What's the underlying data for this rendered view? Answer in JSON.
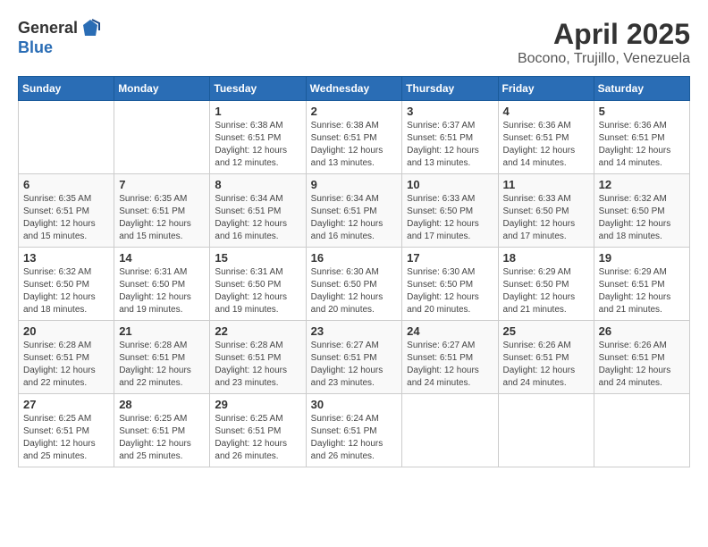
{
  "logo": {
    "general": "General",
    "blue": "Blue"
  },
  "title": {
    "month": "April 2025",
    "location": "Bocono, Trujillo, Venezuela"
  },
  "weekdays": [
    "Sunday",
    "Monday",
    "Tuesday",
    "Wednesday",
    "Thursday",
    "Friday",
    "Saturday"
  ],
  "weeks": [
    [
      {
        "day": "",
        "sunrise": "",
        "sunset": "",
        "daylight": ""
      },
      {
        "day": "",
        "sunrise": "",
        "sunset": "",
        "daylight": ""
      },
      {
        "day": "1",
        "sunrise": "Sunrise: 6:38 AM",
        "sunset": "Sunset: 6:51 PM",
        "daylight": "Daylight: 12 hours and 12 minutes."
      },
      {
        "day": "2",
        "sunrise": "Sunrise: 6:38 AM",
        "sunset": "Sunset: 6:51 PM",
        "daylight": "Daylight: 12 hours and 13 minutes."
      },
      {
        "day": "3",
        "sunrise": "Sunrise: 6:37 AM",
        "sunset": "Sunset: 6:51 PM",
        "daylight": "Daylight: 12 hours and 13 minutes."
      },
      {
        "day": "4",
        "sunrise": "Sunrise: 6:36 AM",
        "sunset": "Sunset: 6:51 PM",
        "daylight": "Daylight: 12 hours and 14 minutes."
      },
      {
        "day": "5",
        "sunrise": "Sunrise: 6:36 AM",
        "sunset": "Sunset: 6:51 PM",
        "daylight": "Daylight: 12 hours and 14 minutes."
      }
    ],
    [
      {
        "day": "6",
        "sunrise": "Sunrise: 6:35 AM",
        "sunset": "Sunset: 6:51 PM",
        "daylight": "Daylight: 12 hours and 15 minutes."
      },
      {
        "day": "7",
        "sunrise": "Sunrise: 6:35 AM",
        "sunset": "Sunset: 6:51 PM",
        "daylight": "Daylight: 12 hours and 15 minutes."
      },
      {
        "day": "8",
        "sunrise": "Sunrise: 6:34 AM",
        "sunset": "Sunset: 6:51 PM",
        "daylight": "Daylight: 12 hours and 16 minutes."
      },
      {
        "day": "9",
        "sunrise": "Sunrise: 6:34 AM",
        "sunset": "Sunset: 6:51 PM",
        "daylight": "Daylight: 12 hours and 16 minutes."
      },
      {
        "day": "10",
        "sunrise": "Sunrise: 6:33 AM",
        "sunset": "Sunset: 6:50 PM",
        "daylight": "Daylight: 12 hours and 17 minutes."
      },
      {
        "day": "11",
        "sunrise": "Sunrise: 6:33 AM",
        "sunset": "Sunset: 6:50 PM",
        "daylight": "Daylight: 12 hours and 17 minutes."
      },
      {
        "day": "12",
        "sunrise": "Sunrise: 6:32 AM",
        "sunset": "Sunset: 6:50 PM",
        "daylight": "Daylight: 12 hours and 18 minutes."
      }
    ],
    [
      {
        "day": "13",
        "sunrise": "Sunrise: 6:32 AM",
        "sunset": "Sunset: 6:50 PM",
        "daylight": "Daylight: 12 hours and 18 minutes."
      },
      {
        "day": "14",
        "sunrise": "Sunrise: 6:31 AM",
        "sunset": "Sunset: 6:50 PM",
        "daylight": "Daylight: 12 hours and 19 minutes."
      },
      {
        "day": "15",
        "sunrise": "Sunrise: 6:31 AM",
        "sunset": "Sunset: 6:50 PM",
        "daylight": "Daylight: 12 hours and 19 minutes."
      },
      {
        "day": "16",
        "sunrise": "Sunrise: 6:30 AM",
        "sunset": "Sunset: 6:50 PM",
        "daylight": "Daylight: 12 hours and 20 minutes."
      },
      {
        "day": "17",
        "sunrise": "Sunrise: 6:30 AM",
        "sunset": "Sunset: 6:50 PM",
        "daylight": "Daylight: 12 hours and 20 minutes."
      },
      {
        "day": "18",
        "sunrise": "Sunrise: 6:29 AM",
        "sunset": "Sunset: 6:50 PM",
        "daylight": "Daylight: 12 hours and 21 minutes."
      },
      {
        "day": "19",
        "sunrise": "Sunrise: 6:29 AM",
        "sunset": "Sunset: 6:51 PM",
        "daylight": "Daylight: 12 hours and 21 minutes."
      }
    ],
    [
      {
        "day": "20",
        "sunrise": "Sunrise: 6:28 AM",
        "sunset": "Sunset: 6:51 PM",
        "daylight": "Daylight: 12 hours and 22 minutes."
      },
      {
        "day": "21",
        "sunrise": "Sunrise: 6:28 AM",
        "sunset": "Sunset: 6:51 PM",
        "daylight": "Daylight: 12 hours and 22 minutes."
      },
      {
        "day": "22",
        "sunrise": "Sunrise: 6:28 AM",
        "sunset": "Sunset: 6:51 PM",
        "daylight": "Daylight: 12 hours and 23 minutes."
      },
      {
        "day": "23",
        "sunrise": "Sunrise: 6:27 AM",
        "sunset": "Sunset: 6:51 PM",
        "daylight": "Daylight: 12 hours and 23 minutes."
      },
      {
        "day": "24",
        "sunrise": "Sunrise: 6:27 AM",
        "sunset": "Sunset: 6:51 PM",
        "daylight": "Daylight: 12 hours and 24 minutes."
      },
      {
        "day": "25",
        "sunrise": "Sunrise: 6:26 AM",
        "sunset": "Sunset: 6:51 PM",
        "daylight": "Daylight: 12 hours and 24 minutes."
      },
      {
        "day": "26",
        "sunrise": "Sunrise: 6:26 AM",
        "sunset": "Sunset: 6:51 PM",
        "daylight": "Daylight: 12 hours and 24 minutes."
      }
    ],
    [
      {
        "day": "27",
        "sunrise": "Sunrise: 6:25 AM",
        "sunset": "Sunset: 6:51 PM",
        "daylight": "Daylight: 12 hours and 25 minutes."
      },
      {
        "day": "28",
        "sunrise": "Sunrise: 6:25 AM",
        "sunset": "Sunset: 6:51 PM",
        "daylight": "Daylight: 12 hours and 25 minutes."
      },
      {
        "day": "29",
        "sunrise": "Sunrise: 6:25 AM",
        "sunset": "Sunset: 6:51 PM",
        "daylight": "Daylight: 12 hours and 26 minutes."
      },
      {
        "day": "30",
        "sunrise": "Sunrise: 6:24 AM",
        "sunset": "Sunset: 6:51 PM",
        "daylight": "Daylight: 12 hours and 26 minutes."
      },
      {
        "day": "",
        "sunrise": "",
        "sunset": "",
        "daylight": ""
      },
      {
        "day": "",
        "sunrise": "",
        "sunset": "",
        "daylight": ""
      },
      {
        "day": "",
        "sunrise": "",
        "sunset": "",
        "daylight": ""
      }
    ]
  ]
}
